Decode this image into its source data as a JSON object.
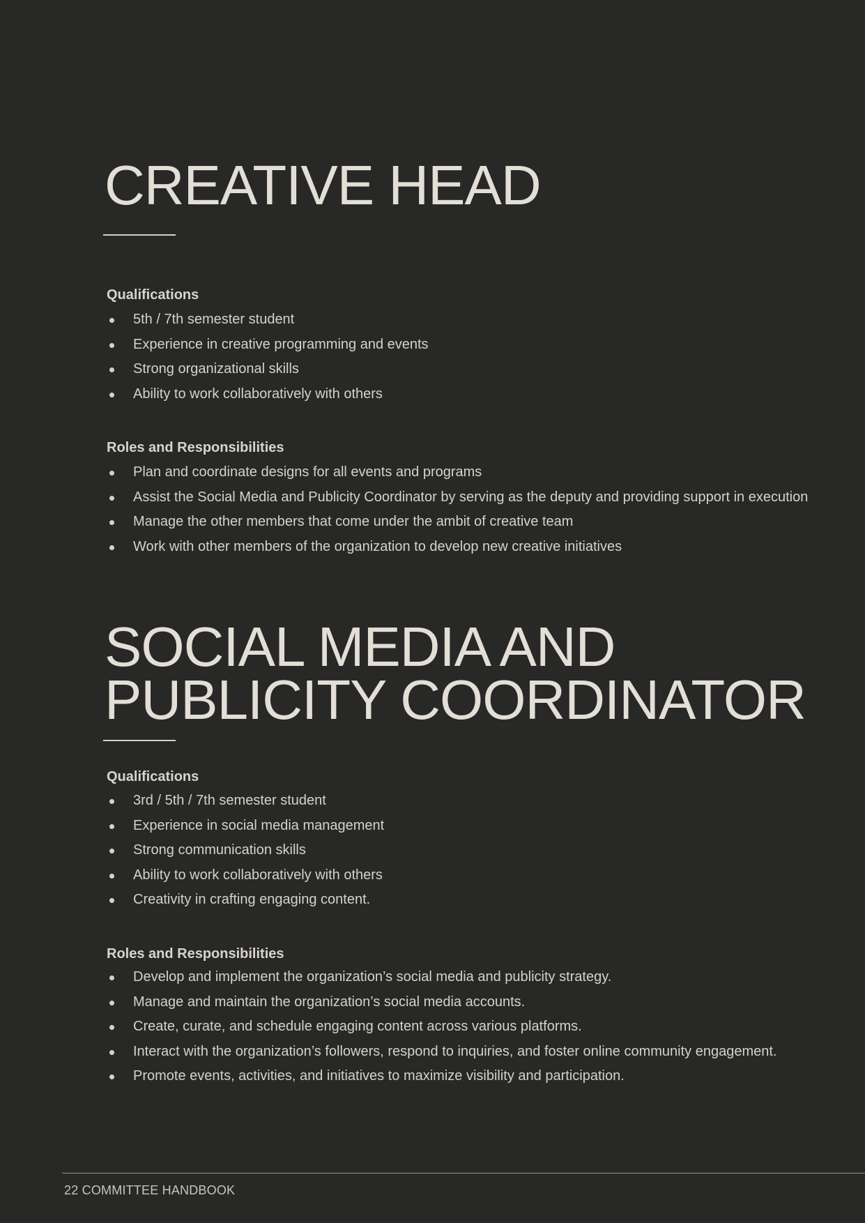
{
  "sections": [
    {
      "title": "CREATIVE HEAD",
      "qualifications_heading": "Qualifications",
      "qualifications": [
        "5th / 7th semester student",
        "Experience in creative programming and events",
        "Strong organizational skills",
        "Ability to work collaboratively with others"
      ],
      "roles_heading": "Roles and Responsibilities",
      "roles": [
        "Plan and coordinate designs for all events and programs",
        "Assist the Social Media and Publicity Coordinator by serving as the deputy and providing support in execution",
        "Manage the other members that come under the ambit of creative team",
        "Work with other members of the organization to develop new creative initiatives"
      ]
    },
    {
      "title": "SOCIAL MEDIA AND\nPUBLICITY COORDINATOR",
      "qualifications_heading": "Qualifications",
      "qualifications": [
        "3rd / 5th / 7th semester student",
        "Experience in social media management",
        "Strong communication skills",
        "Ability to work collaboratively with others",
        "Creativity in crafting engaging content."
      ],
      "roles_heading": "Roles and Responsibilities",
      "roles": [
        "Develop and implement the organization’s social media and publicity strategy.",
        "Manage and maintain the organization’s social media accounts.",
        "Create, curate, and schedule engaging content across various platforms.",
        "Interact with the organization’s followers, respond to inquiries, and foster online community engagement.",
        "Promote events, activities, and initiatives to maximize visibility and participation."
      ]
    }
  ],
  "footer": {
    "text": "22 COMMITTEE HANDBOOK"
  }
}
